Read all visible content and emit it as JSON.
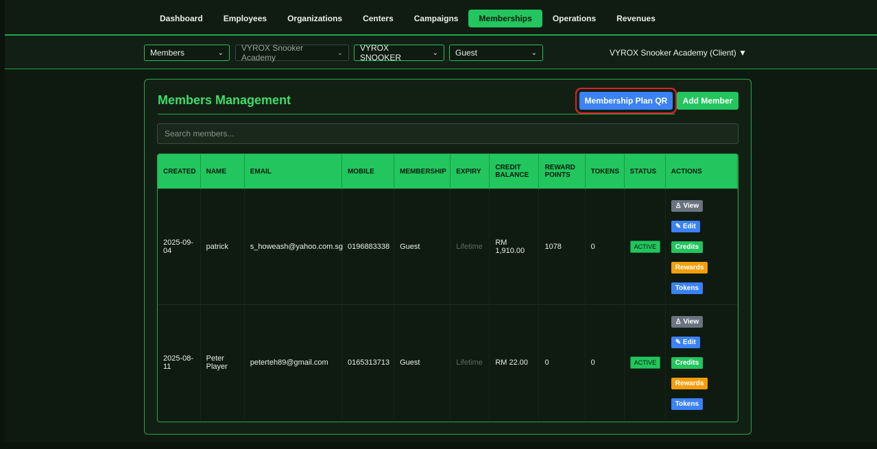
{
  "nav": {
    "items": [
      {
        "label": "Dashboard"
      },
      {
        "label": "Employees"
      },
      {
        "label": "Organizations"
      },
      {
        "label": "Centers"
      },
      {
        "label": "Campaigns"
      },
      {
        "label": "Memberships",
        "active": true
      },
      {
        "label": "Operations"
      },
      {
        "label": "Revenues"
      }
    ]
  },
  "filters": {
    "section": "Members",
    "organization": "VYROX Snooker Academy",
    "center": "VYROX SNOOKER",
    "membership": "Guest",
    "client_label": "VYROX Snooker Academy (Client) ▼"
  },
  "panel": {
    "title": "Members Management",
    "qr_button": "Membership Plan QR",
    "add_button": "Add Member",
    "search_placeholder": "Search members..."
  },
  "table": {
    "headers": [
      "CREATED",
      "NAME",
      "EMAIL",
      "MOBILE",
      "MEMBERSHIP",
      "EXPIRY",
      "CREDIT BALANCE",
      "REWARD POINTS",
      "TOKENS",
      "STATUS",
      "ACTIONS"
    ],
    "rows": [
      {
        "created": "2025-09-04",
        "name": "patrick",
        "email": "s_howeash@yahoo.com.sg",
        "mobile": "0196883338",
        "membership": "Guest",
        "expiry": "Lifetime",
        "credit": "RM 1,910.00",
        "points": "1078",
        "tokens": "0",
        "status": "ACTIVE"
      },
      {
        "created": "2025-08-11",
        "name": "Peter Player",
        "email": "peterteh89@gmail.com",
        "mobile": "0165313713",
        "membership": "Guest",
        "expiry": "Lifetime",
        "credit": "RM 22.00",
        "points": "0",
        "tokens": "0",
        "status": "ACTIVE"
      }
    ],
    "actions": {
      "view": "View",
      "edit": "Edit",
      "credits": "Credits",
      "rewards": "Rewards",
      "tokens": "Tokens"
    }
  },
  "colors": {
    "accent": "#22c55e",
    "primary": "#3b82f6",
    "warning": "#f59e0b",
    "annotation": "#e0202a"
  }
}
